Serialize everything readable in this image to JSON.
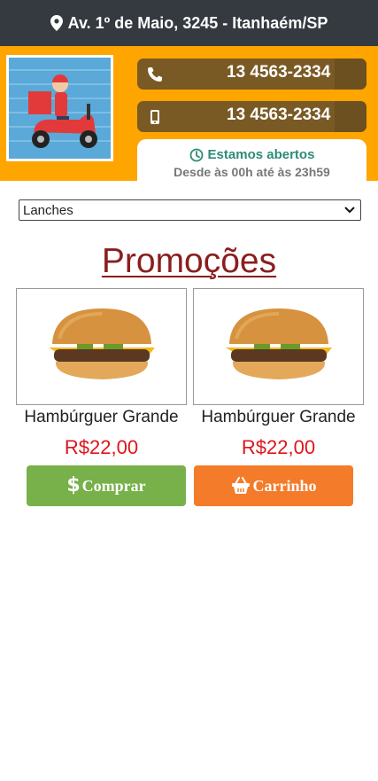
{
  "header": {
    "address": "Av. 1º de Maio, 3245 - Itanhaém/SP",
    "address_icon": "map-marker-icon"
  },
  "contact": {
    "phone": "13 4563-2334",
    "phone_icon": "phone-icon",
    "mobile": "13 4563-2334",
    "mobile_icon": "mobile-phone-icon"
  },
  "hours": {
    "status": "Estamos abertos",
    "range": "Desde às 00h até às 23h59",
    "status_color": "#2e8b78"
  },
  "filter": {
    "selected": "Lanches"
  },
  "promotions": {
    "title": "Promoções",
    "products": [
      {
        "name": "Hambúrguer Grande",
        "price": "R$22,00"
      },
      {
        "name": "Hambúrguer Grande",
        "price": "R$22,00"
      }
    ]
  },
  "actions": {
    "buy_label": "Comprar",
    "cart_label": "Carrinho",
    "buy_color": "#78b04a",
    "cart_color": "#f47b2a"
  },
  "colors": {
    "topbar": "#343a40",
    "hero": "#ffa500",
    "title": "#8b1e1e",
    "price": "#e0141c"
  }
}
